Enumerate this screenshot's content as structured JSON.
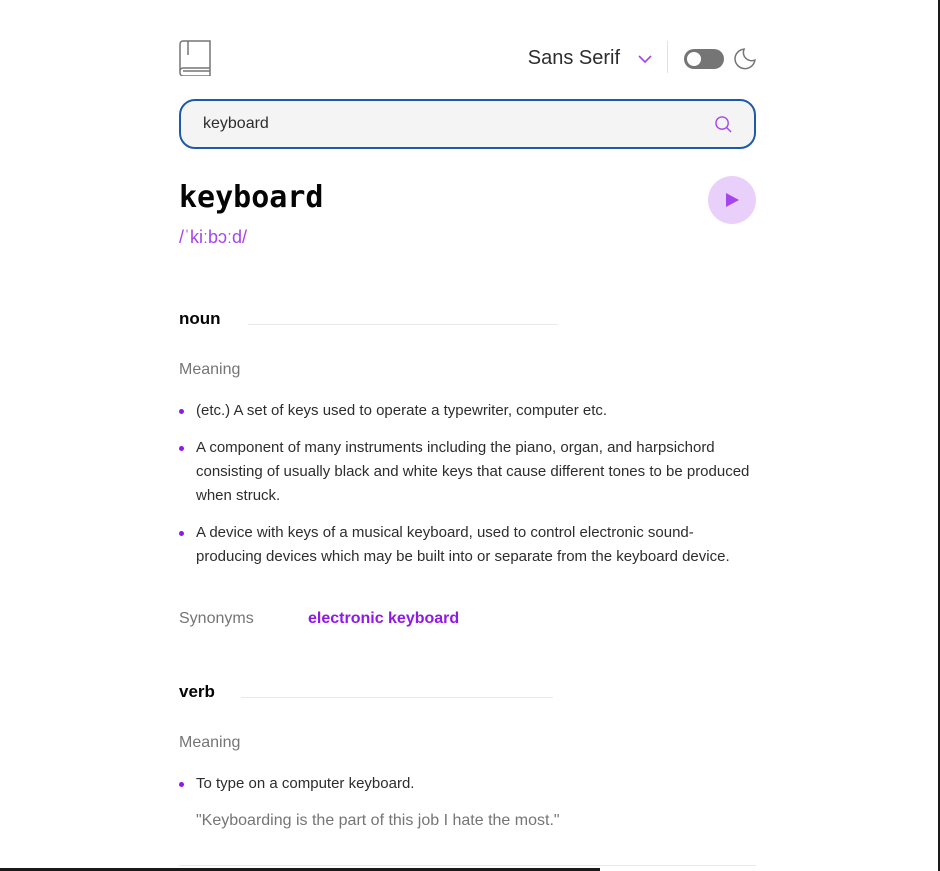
{
  "header": {
    "logo_icon": "book-icon",
    "font_label": "Sans Serif",
    "theme_toggle_on": false,
    "theme_icon": "moon-icon"
  },
  "search": {
    "value": "keyboard",
    "icon": "search-icon"
  },
  "entry": {
    "word": "keyboard",
    "phonetic": "/ˈkiːbɔːd/",
    "play_icon": "play-icon"
  },
  "noun": {
    "label": "noun",
    "meaning_heading": "Meaning",
    "definitions": [
      "(etc.) A set of keys used to operate a typewriter, computer etc.",
      "A component of many instruments including the piano, organ, and harpsichord consisting of usually black and white keys that cause different tones to be produced when struck.",
      "A device with keys of a musical keyboard, used to control electronic sound-producing devices which may be built into or separate from the keyboard device."
    ],
    "synonyms_label": "Synonyms",
    "synonyms": [
      "electronic keyboard"
    ]
  },
  "verb": {
    "label": "verb",
    "meaning_heading": "Meaning",
    "definitions": [
      "To type on a computer keyboard."
    ],
    "example": "\"Keyboarding is the part of this job I hate the most.\""
  },
  "colors": {
    "accent": "#a445ed",
    "accent_dark": "#8f19e8",
    "search_border": "#1e5aa8",
    "play_bg": "#e9d0fa"
  }
}
